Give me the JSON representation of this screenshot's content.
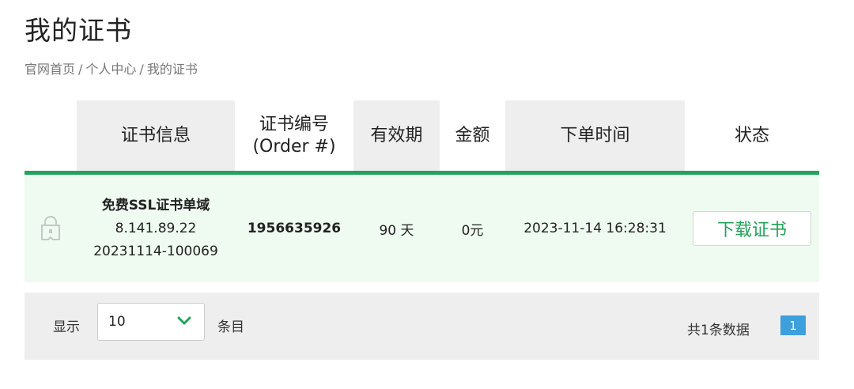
{
  "page": {
    "title": "我的证书",
    "breadcrumb": [
      "官网首页",
      "个人中心",
      "我的证书"
    ],
    "breadcrumb_sep": "/"
  },
  "table": {
    "headers": {
      "info": "证书信息",
      "order_line1": "证书编号",
      "order_line2": "(Order #)",
      "valid": "有效期",
      "amount": "金额",
      "time": "下单时间",
      "status": "状态"
    },
    "rows": [
      {
        "icon": "certificate-lock-icon",
        "name": "免费SSL证书单域",
        "domain": "8.141.89.22",
        "code": "20231114-100069",
        "order_no": "1956635926",
        "valid": "90 天",
        "amount": "0元",
        "time": "2023-11-14 16:28:31",
        "action": "下载证书"
      }
    ]
  },
  "footer": {
    "show_label": "显示",
    "page_size": "10",
    "entries_label": "条目",
    "total_text": "共1条数据",
    "current_page": "1"
  },
  "colors": {
    "accent_green": "#21a35a",
    "row_bg": "#effbf1",
    "header_shade": "#eeeeee",
    "page_blue": "#3da0dd"
  }
}
